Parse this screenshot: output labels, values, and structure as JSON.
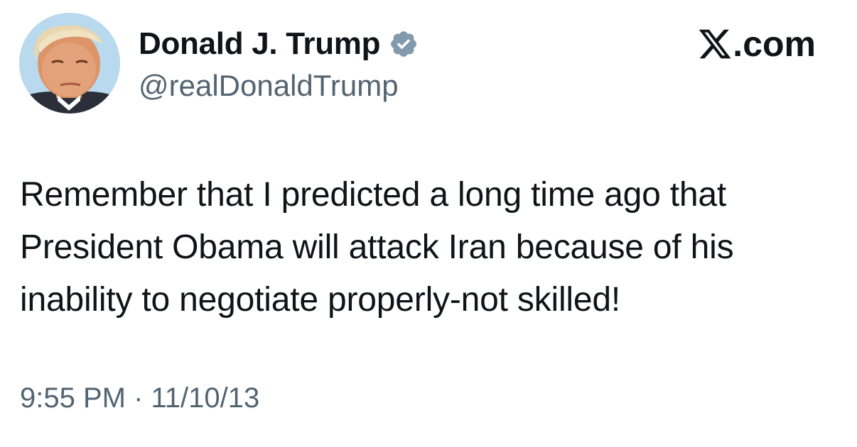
{
  "author": {
    "display_name": "Donald J. Trump",
    "handle": "@realDonaldTrump",
    "verified": true,
    "verified_icon": "verified-badge-icon",
    "avatar_icon": "profile-photo",
    "verified_color": "#829aab"
  },
  "brand": {
    "logo_icon": "x-logo-icon",
    "text": ".com"
  },
  "tweet": {
    "text": "Remember that I predicted a long time ago that President Obama will attack Iran because of his inability to negotiate properly-not skilled!",
    "timestamp": "9:55 PM · 11/10/13"
  },
  "colors": {
    "text_primary": "#0f1419",
    "text_secondary": "#536471",
    "background": "#ffffff"
  }
}
